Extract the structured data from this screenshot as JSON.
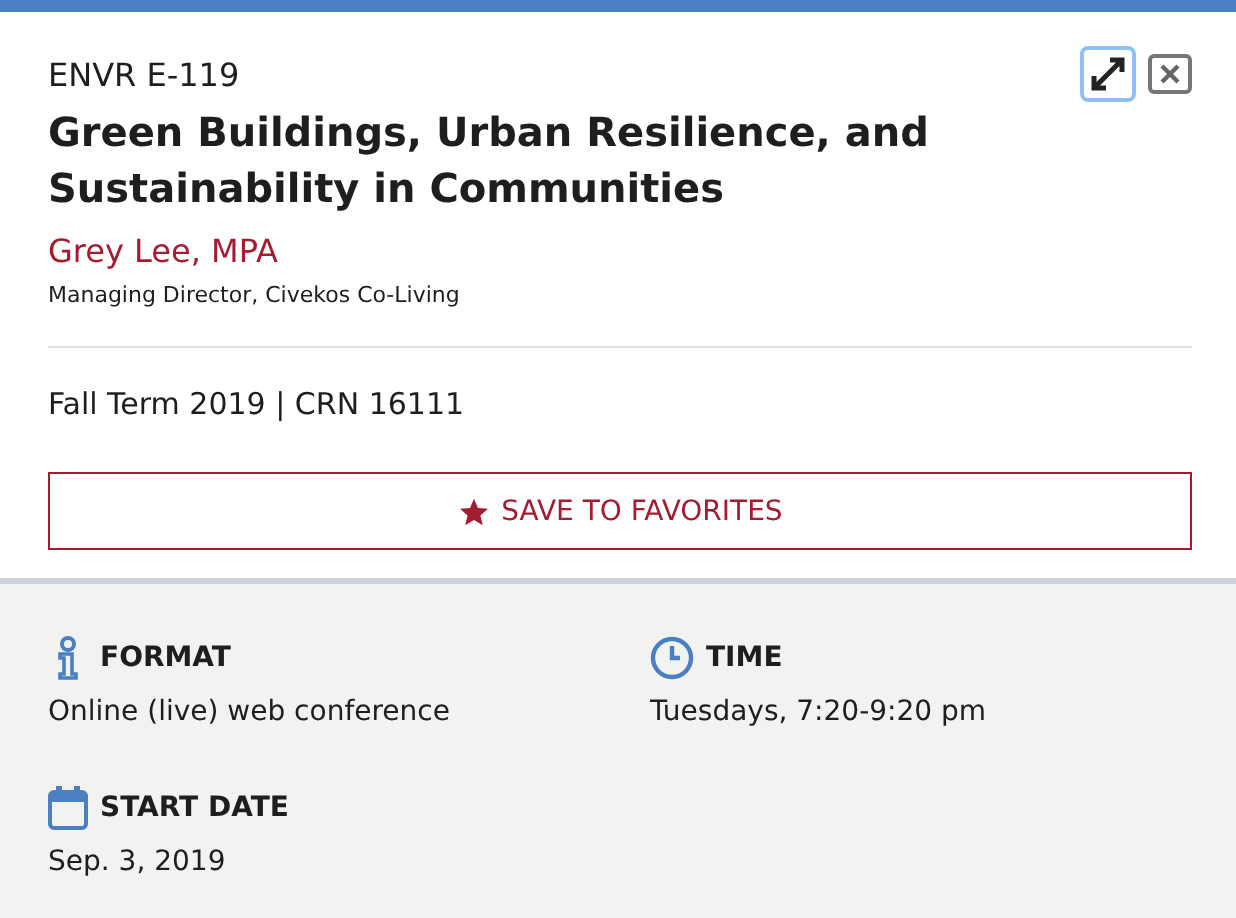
{
  "course": {
    "code": "ENVR E-119",
    "title": "Green Buildings, Urban Resilience, and Sustainability in Communities",
    "instructor": "Grey Lee, MPA",
    "instructor_role": "Managing Director, Civekos Co-Living",
    "term": "Fall Term 2019 | CRN 16111"
  },
  "favorite_button": {
    "label": "SAVE TO FAVORITES"
  },
  "details": [
    {
      "kind": "info",
      "heading": "FORMAT",
      "value": "Online (live) web conference"
    },
    {
      "kind": "clock",
      "heading": "TIME",
      "value": "Tuesdays, 7:20-9:20 pm"
    },
    {
      "kind": "calendar",
      "heading": "START DATE",
      "value": "Sep. 3, 2019"
    }
  ]
}
